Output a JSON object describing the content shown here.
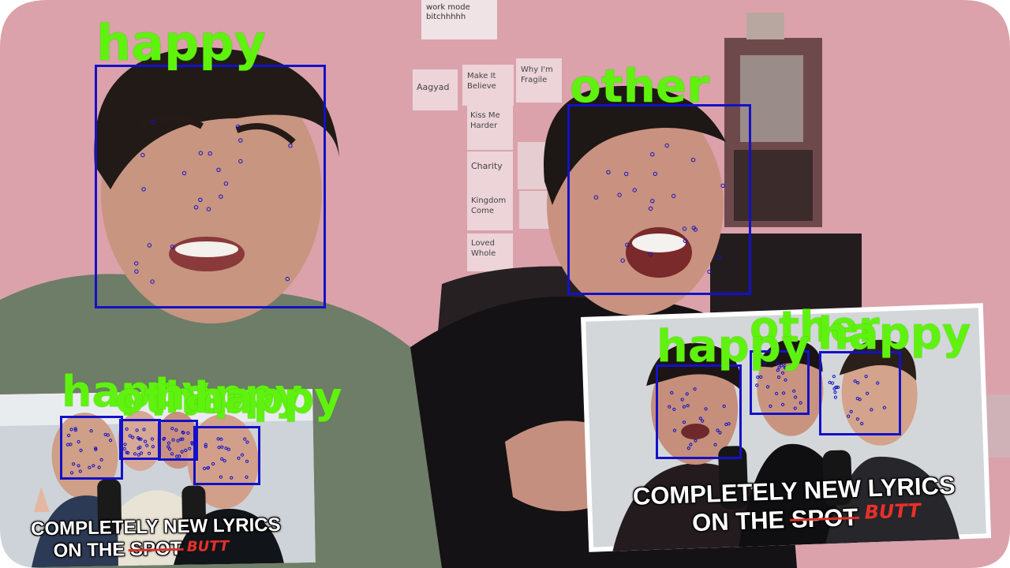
{
  "scene": {
    "colors": {
      "wall": "#d79aa5",
      "box": "#1411c8",
      "label": "#5ff20f",
      "strike": "#d8302a"
    }
  },
  "wall_notes": [
    "work mode bitchhhhh",
    "Aagyad",
    "Make It Believe",
    "Why I'm Fragile",
    "Kiss Me Harder",
    "Charity",
    "Kingdom Come",
    "Loved Whole"
  ],
  "thumbnails": [
    {
      "line1": "COMPLETELY NEW LYRICS",
      "line2_prefix": "ON THE ",
      "struck": "SPOT",
      "replacement": "BUTT"
    },
    {
      "line1": "COMPLETELY NEW LYRICS",
      "line2_prefix": "ON THE ",
      "struck": "SPOT",
      "replacement": "BUTT"
    }
  ],
  "detections": [
    {
      "label": "happy"
    },
    {
      "label": "other"
    },
    {
      "label": "happy"
    },
    {
      "label": "other"
    },
    {
      "label": "happy"
    },
    {
      "label": "happy"
    },
    {
      "label": "other"
    },
    {
      "label": "happy"
    },
    {
      "label": "happy"
    }
  ]
}
